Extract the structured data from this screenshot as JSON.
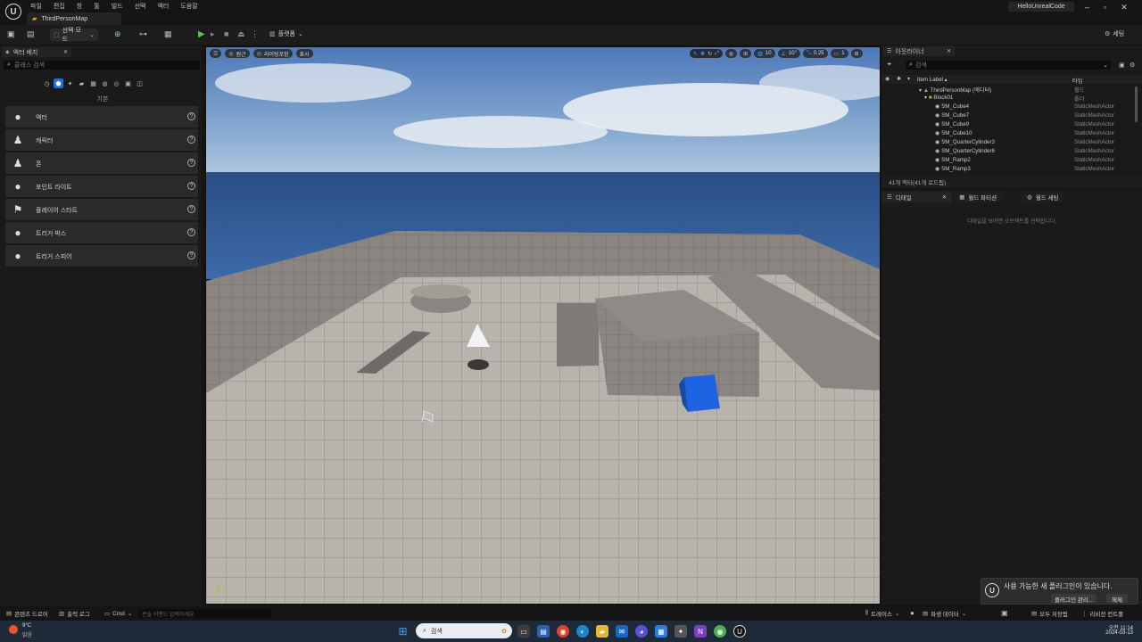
{
  "app": {
    "menu": [
      "파일",
      "편집",
      "창",
      "툴",
      "빌드",
      "선택",
      "액터",
      "도움말"
    ],
    "map_tab": "ThirdPersonMap",
    "project_name": "HelloUnrealCode",
    "window_buttons": {
      "minimize": "–",
      "maximize": "▫",
      "close": "✕"
    }
  },
  "toolbar": {
    "mode_label": "선택 모드",
    "platform_label": "플랫폼",
    "settings_label": "세팅"
  },
  "place_actors": {
    "tab_title": "액터 배치",
    "search_placeholder": "클래스 검색",
    "category_label": "기본",
    "items": [
      {
        "label": "액터",
        "icon": "actor-sphere-icon",
        "glyph": "●"
      },
      {
        "label": "캐릭터",
        "icon": "character-icon",
        "glyph": "♟"
      },
      {
        "label": "폰",
        "icon": "pawn-icon",
        "glyph": "♟"
      },
      {
        "label": "포인트 라이트",
        "icon": "point-light-icon",
        "glyph": "💡"
      },
      {
        "label": "플레이어 스타트",
        "icon": "player-start-icon",
        "glyph": "⚑"
      },
      {
        "label": "트리거 박스",
        "icon": "trigger-box-icon",
        "glyph": "●"
      },
      {
        "label": "트리거 스피어",
        "icon": "trigger-sphere-icon",
        "glyph": "●"
      }
    ]
  },
  "viewport": {
    "perspective_label": "원근",
    "lit_label": "라이팅포함",
    "show_label": "표시",
    "grid_size": "10",
    "rotation_snap": "10°",
    "scale_snap": "0.25",
    "camera_speed": "1"
  },
  "outliner": {
    "tab_title": "아웃라이너",
    "search_placeholder": "검색",
    "col_label": "Item Label ▴",
    "col_type": "타입",
    "rows": [
      {
        "name": "ThirdPersonMap (에디터)",
        "type": "월드",
        "indent": 0
      },
      {
        "name": "Block01",
        "type": "폴더",
        "indent": 1
      },
      {
        "name": "SM_Cube4",
        "type": "StaticMeshActor",
        "indent": 2
      },
      {
        "name": "SM_Cube7",
        "type": "StaticMeshActor",
        "indent": 2
      },
      {
        "name": "SM_Cube9",
        "type": "StaticMeshActor",
        "indent": 2
      },
      {
        "name": "SM_Cube10",
        "type": "StaticMeshActor",
        "indent": 2
      },
      {
        "name": "SM_QuarterCylinder3",
        "type": "StaticMeshActor",
        "indent": 2
      },
      {
        "name": "SM_QuarterCylinder6",
        "type": "StaticMeshActor",
        "indent": 2
      },
      {
        "name": "SM_Ramp2",
        "type": "StaticMeshActor",
        "indent": 2
      },
      {
        "name": "SM_Ramp3",
        "type": "StaticMeshActor",
        "indent": 2
      }
    ],
    "count_label": "41개 액터(41개 로드됨)"
  },
  "details": {
    "tabs": [
      "디테일",
      "월드 파티션",
      "월드 세팅"
    ],
    "empty_text": "디테일을 보려면 오브젝트를 선택합니다."
  },
  "notification": {
    "message": "사용 가능한 새 플러그인이 있습니다.",
    "manage_button": "플러그인 관리...",
    "dismiss_button": "해제"
  },
  "statusbar": {
    "content_drawer": "콘텐츠 드로어",
    "output_log": "출력 로그",
    "cmd_label": "Cmd",
    "console_placeholder": "콘솔 커맨드 입력하세요",
    "trace": "트레이스",
    "derived_data": "파생 데이터",
    "all_saved": "모두 저장됨",
    "revision_control": "리비전 컨트롤"
  },
  "taskbar": {
    "weather_temp": "9°C",
    "weather_text": "맑음",
    "search_label": "검색",
    "time": "오전 11:14",
    "date": "2024-03-13"
  }
}
